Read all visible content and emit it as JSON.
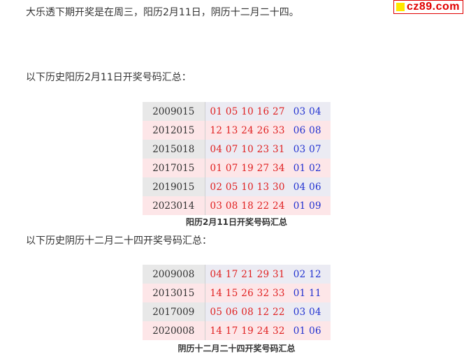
{
  "intro_text": "大乐透下期开奖是在周三，阳历2月11日，阴历十二月二十四。",
  "site_badge": "cz89.com",
  "solar_heading": "以下历史阳历2月11日开奖号码汇总：",
  "solar_table": {
    "rows": [
      {
        "period": "2009015",
        "front": "01 05 10 16 27",
        "back": "03 04"
      },
      {
        "period": "2012015",
        "front": "12 13 24 26 33",
        "back": "06 08"
      },
      {
        "period": "2015018",
        "front": "04 07 10 23 31",
        "back": "03 07"
      },
      {
        "period": "2017015",
        "front": "01 07 19 27 34",
        "back": "01 02"
      },
      {
        "period": "2019015",
        "front": "02 05 10 13 30",
        "back": "04 06"
      },
      {
        "period": "2023014",
        "front": "03 08 18 22 24",
        "back": "01 09"
      }
    ],
    "caption": "阳历2月11日开奖号码汇总"
  },
  "lunar_heading": "以下历史阴历十二月二十四开奖号码汇总：",
  "lunar_table": {
    "rows": [
      {
        "period": "2009008",
        "front": "04 17 21 29 31",
        "back": "02 12"
      },
      {
        "period": "2013015",
        "front": "14 15 26 32 33",
        "back": "01 11"
      },
      {
        "period": "2017009",
        "front": "05 06 08 12 22",
        "back": "03 04"
      },
      {
        "period": "2020008",
        "front": "14 17 19 24 32",
        "back": "01 06"
      }
    ],
    "caption": "阴历十二月二十四开奖号码汇总"
  },
  "colors": {
    "front_ball": "#e02020",
    "back_ball": "#2030d0",
    "badge_border": "#e00000",
    "badge_dot": "#ffe800"
  },
  "icons": {
    "badge_mark": "yellow-square-icon"
  }
}
